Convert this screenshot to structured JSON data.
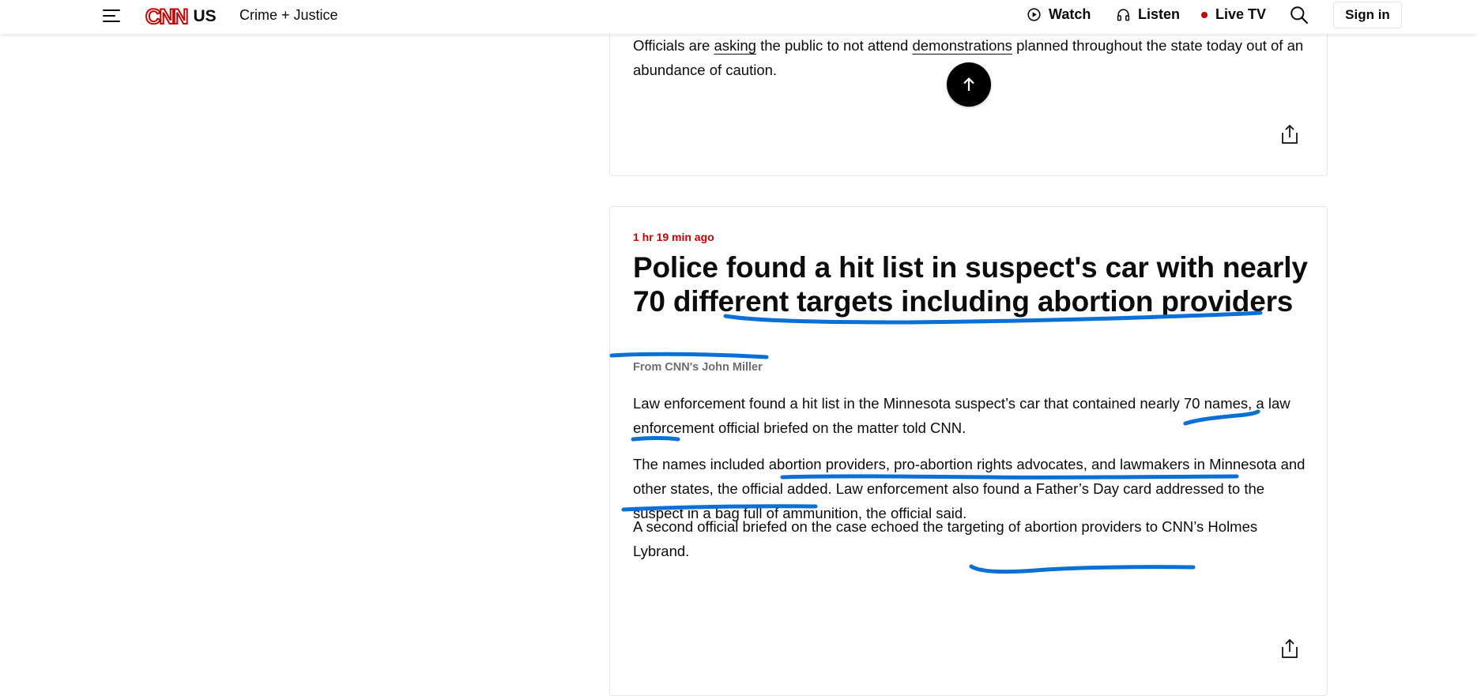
{
  "header": {
    "logo_text": "CNN",
    "logo_edition": "US",
    "section_label": "Crime + Justice",
    "watch_label": "Watch",
    "listen_label": "Listen",
    "live_tv_label": "Live TV",
    "sign_in_label": "Sign in",
    "icons": {
      "menu": "hamburger-icon",
      "watch": "play-circle-icon",
      "listen": "headphones-icon",
      "live": "live-dot-icon",
      "search": "search-icon"
    },
    "live_color": "#cc0000"
  },
  "post_1": {
    "text_before_asking": "Officials are ",
    "link_asking": "asking",
    "text_middle": " the public to not attend ",
    "link_demonstrations": "demonstrations",
    "text_after": " planned throughout the state today out of an abundance of caution.",
    "share_icon": "share-icon"
  },
  "post_2": {
    "timestamp": "1 hr 19 min ago",
    "headline": "Police found a hit list in suspect's car with nearly 70 different targets including abortion providers",
    "byline": "From CNN's John Miller",
    "paragraph_1": "Law enforcement found a hit list in the Minnesota suspect’s car that contained nearly 70 names, a law enforcement official briefed on the matter told CNN.",
    "paragraph_2": "The names included abortion providers, pro-abortion rights advocates, and lawmakers in Minnesota and other states, the official added. Law enforcement also found a Father’s Day card addressed to the suspect in a bag full of ammunition, the official said.",
    "paragraph_3": "A second official briefed on the case echoed the targeting of abortion providers to CNN’s Holmes Lybrand.",
    "share_icon": "share-icon"
  },
  "scroll_to_top_icon": "arrow-up-icon",
  "colors": {
    "accent_red": "#cc0000",
    "annotation_blue": "#0a6fd6"
  }
}
